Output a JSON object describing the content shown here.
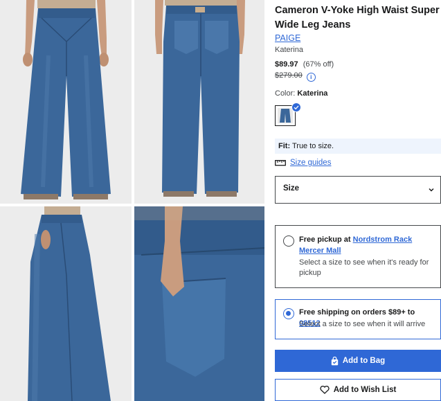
{
  "product": {
    "title": "Cameron V-Yoke High Waist Super Wide Leg Jeans",
    "brand": "PAIGE",
    "variant_name": "Katerina",
    "price": "$89.97",
    "discount": "(67% off)",
    "original_price": "$279.00"
  },
  "color": {
    "label": "Color:",
    "value": "Katerina"
  },
  "fit": {
    "label": "Fit:",
    "value": "True to size."
  },
  "size_guides_label": "Size guides",
  "size_select": {
    "label": "Size"
  },
  "pickup": {
    "prefix": "Free pickup at",
    "store": "Nordstrom Rack Mercer Mall",
    "note": "Select a size to see when it's ready for pickup",
    "selected": false
  },
  "shipping": {
    "prefix": "Free shipping on orders $89+ to",
    "zip": "08512",
    "note": "Select a size to see when it will arrive",
    "selected": true
  },
  "buttons": {
    "add_to_bag": "Add to Bag",
    "add_to_wishlist": "Add to Wish List"
  },
  "colors": {
    "accent": "#2f68d6",
    "denim": "#3b679a",
    "fit_bg": "#eef4fd"
  }
}
